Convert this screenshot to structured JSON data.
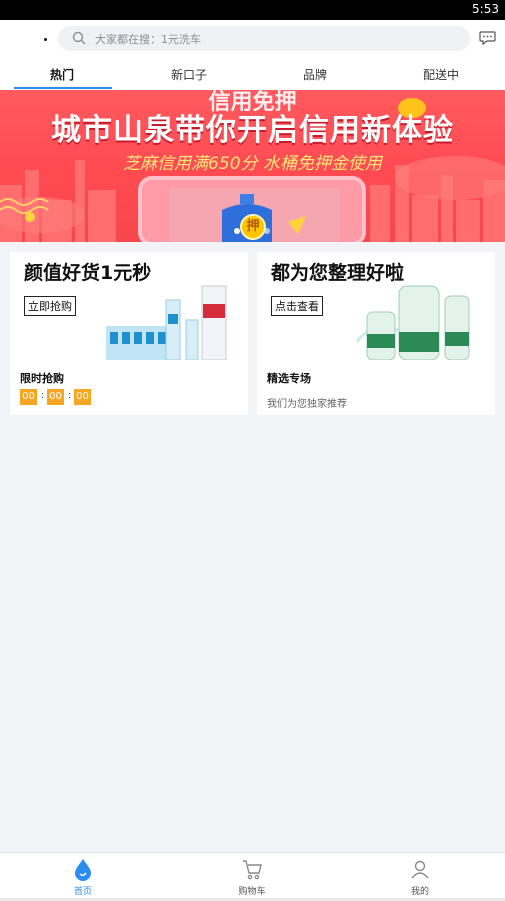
{
  "status_bar": {
    "time": "5:53"
  },
  "search": {
    "placeholder": "大家都在搜：1元洗车"
  },
  "tabs": [
    {
      "label": "热门",
      "active": true
    },
    {
      "label": "新口子",
      "active": false
    },
    {
      "label": "品牌",
      "active": false
    },
    {
      "label": "配送中",
      "active": false
    }
  ],
  "banner": {
    "top_text": "信用免押",
    "headline": "城市山泉带你开启信用新体验",
    "subline": "芝麻信用满650分 水桶免押金使用",
    "badge": "押"
  },
  "cards": [
    {
      "title": "颜值好货1元秒",
      "cta": "立即抢购",
      "name": "限时抢购",
      "timer": [
        "00",
        "00",
        "00"
      ]
    },
    {
      "title": "都为您整理好啦",
      "cta": "点击查看",
      "name": "精选专场",
      "desc": "我们为您独家推荐"
    }
  ],
  "bottom_nav": [
    {
      "label": "首页",
      "icon": "water-drop-icon",
      "active": true
    },
    {
      "label": "购物车",
      "icon": "cart-icon",
      "active": false
    },
    {
      "label": "我的",
      "icon": "user-icon",
      "active": false
    }
  ],
  "colors": {
    "accent": "#2d8cf0",
    "banner": "#ff4a52",
    "timer": "#f5a623"
  }
}
